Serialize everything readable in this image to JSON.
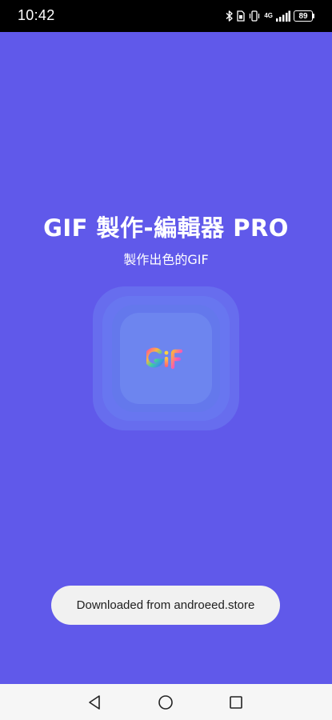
{
  "status_bar": {
    "time": "10:42",
    "network_label": "4G",
    "battery_level": "89"
  },
  "app": {
    "title": "GIF 製作-編輯器 PRO",
    "subtitle": "製作出色的GIF"
  },
  "toast": {
    "message": "Downloaded from androeed.store"
  },
  "icons": {
    "bluetooth": "bluetooth-icon",
    "vibrate": "vibrate-icon",
    "signal": "signal-icon",
    "battery": "battery-icon",
    "back": "nav-back-icon",
    "home": "nav-home-icon",
    "recents": "nav-recents-icon",
    "logo": "gif-logo-icon"
  },
  "colors": {
    "background": "#6059EA",
    "status_bar": "#000000",
    "toast_bg": "#F1F1F1",
    "nav_bar": "#F6F6F6"
  }
}
